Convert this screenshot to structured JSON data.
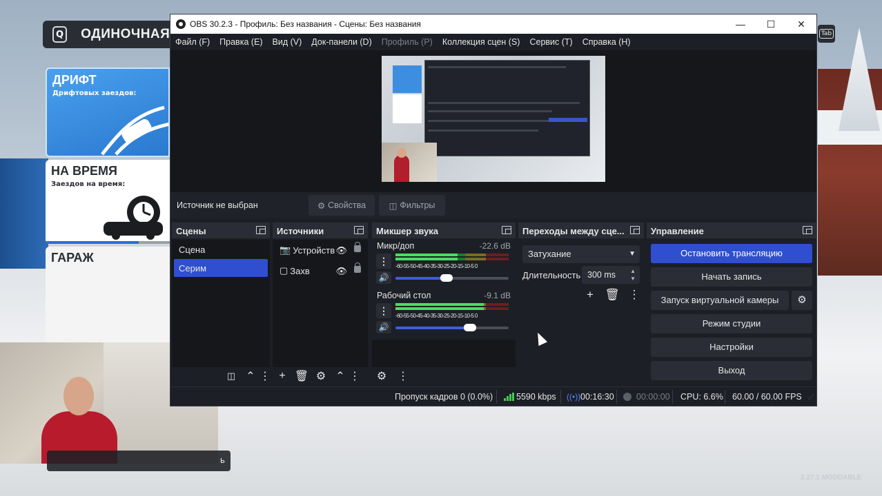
{
  "game": {
    "q_key": "Q",
    "top_title": "ОДИНОЧНАЯ ИГРА",
    "tab_key": "Tab",
    "cards": [
      {
        "title": "ДРИФТ",
        "subtitle": "Дрифтовых заездов:"
      },
      {
        "title": "НА ВРЕМЯ",
        "subtitle": "Заездов на время:"
      },
      {
        "title": "ГАРАЖ",
        "subtitle": ""
      }
    ],
    "bottom_bar_text": "ь",
    "version": "2.27.1 MODDABLE"
  },
  "obs": {
    "title": "OBS 30.2.3 - Профиль: Без названия - Сцены: Без названия",
    "window_buttons": [
      "minimize",
      "maximize",
      "close"
    ],
    "menu": [
      {
        "label": "Файл (F)",
        "enabled": true
      },
      {
        "label": "Правка (E)",
        "enabled": true
      },
      {
        "label": "Вид (V)",
        "enabled": true
      },
      {
        "label": "Док-панели (D)",
        "enabled": true
      },
      {
        "label": "Профиль (P)",
        "enabled": false
      },
      {
        "label": "Коллекция сцен (S)",
        "enabled": true
      },
      {
        "label": "Сервис (T)",
        "enabled": true
      },
      {
        "label": "Справка (H)",
        "enabled": true
      }
    ],
    "source_bar": {
      "label": "Источник не выбран",
      "properties": "Свойства",
      "filters": "Фильтры"
    },
    "scenes": {
      "title": "Сцены",
      "items": [
        "Сцена",
        "Серим"
      ],
      "active_index": 1
    },
    "sources": {
      "title": "Источники",
      "items": [
        {
          "label": "Устройств",
          "icon": "camera-icon"
        },
        {
          "label": "Захв",
          "icon": "monitor-icon"
        }
      ]
    },
    "mixer": {
      "title": "Микшер звука",
      "channels": [
        {
          "name": "Микр/доп",
          "db": "-22.6 dB",
          "level": 0.55,
          "volume": 0.45
        },
        {
          "name": "Рабочий стол",
          "db": "-9.1 dB",
          "level": 0.78,
          "volume": 0.66
        }
      ],
      "scale": "-60-55-50-45-40-35-30-25-20-15-10-5  0"
    },
    "transitions": {
      "title": "Переходы между сце...",
      "selected": "Затухание",
      "duration_label": "Длительность",
      "duration_value": "300 ms"
    },
    "controls": {
      "title": "Управление",
      "stop_stream": "Остановить трансляцию",
      "start_record": "Начать запись",
      "virtual_cam": "Запуск виртуальной камеры",
      "studio_mode": "Режим студии",
      "settings": "Настройки",
      "exit": "Выход"
    },
    "status": {
      "dropped": "Пропуск кадров 0 (0.0%)",
      "bitrate": "5590 kbps",
      "stream_time": "00:16:30",
      "record_time": "00:00:00",
      "cpu": "CPU: 6.6%",
      "fps": "60.00 / 60.00 FPS"
    },
    "colors": {
      "accent": "#2f4fd0",
      "panel": "#1d1f26",
      "meter_green": "#47e060",
      "signal": "#3fcf4f"
    }
  }
}
